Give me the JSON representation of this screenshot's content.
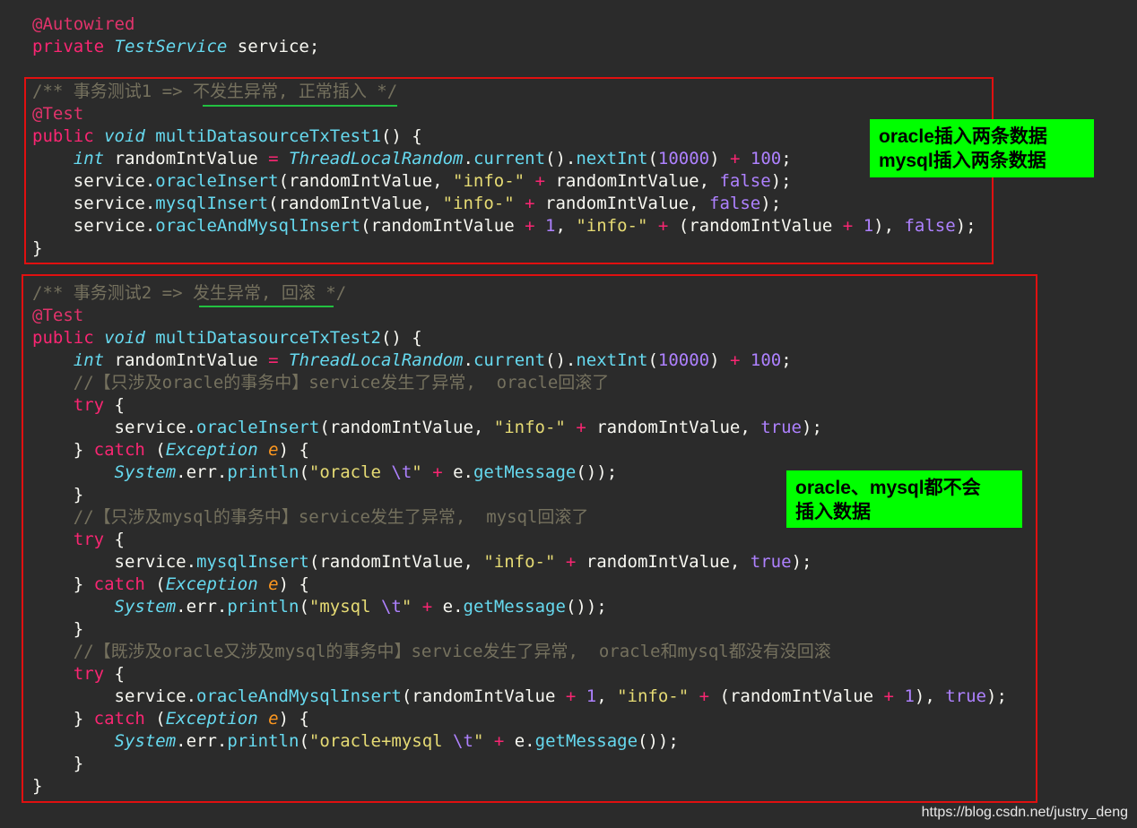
{
  "code_lines": [
    [
      {
        "c": "t-ann",
        "t": "@Autowired"
      }
    ],
    [
      {
        "c": "t-kw",
        "t": "private "
      },
      {
        "c": "t-cls",
        "t": "TestService"
      },
      {
        "c": "t-plain",
        "t": " service;"
      }
    ],
    [],
    [
      {
        "c": "t-cmt",
        "t": "/** 事务测试1 => 不发生异常, 正常插入 */"
      }
    ],
    [
      {
        "c": "t-ann",
        "t": "@Test"
      }
    ],
    [
      {
        "c": "t-kw",
        "t": "public "
      },
      {
        "c": "t-kwi",
        "t": "void"
      },
      {
        "c": "t-plain",
        "t": " "
      },
      {
        "c": "t-fn",
        "t": "multiDatasourceTxTest1"
      },
      {
        "c": "t-plain",
        "t": "() {"
      }
    ],
    [
      {
        "c": "t-plain",
        "t": "    "
      },
      {
        "c": "t-kwi",
        "t": "int"
      },
      {
        "c": "t-plain",
        "t": " randomIntValue "
      },
      {
        "c": "t-op",
        "t": "="
      },
      {
        "c": "t-plain",
        "t": " "
      },
      {
        "c": "t-cls",
        "t": "ThreadLocalRandom"
      },
      {
        "c": "t-plain",
        "t": "."
      },
      {
        "c": "t-fn",
        "t": "current"
      },
      {
        "c": "t-plain",
        "t": "()."
      },
      {
        "c": "t-fn",
        "t": "nextInt"
      },
      {
        "c": "t-plain",
        "t": "("
      },
      {
        "c": "t-num",
        "t": "10000"
      },
      {
        "c": "t-plain",
        "t": ") "
      },
      {
        "c": "t-op",
        "t": "+"
      },
      {
        "c": "t-plain",
        "t": " "
      },
      {
        "c": "t-num",
        "t": "100"
      },
      {
        "c": "t-plain",
        "t": ";"
      }
    ],
    [
      {
        "c": "t-plain",
        "t": "    service."
      },
      {
        "c": "t-fn",
        "t": "oracleInsert"
      },
      {
        "c": "t-plain",
        "t": "(randomIntValue, "
      },
      {
        "c": "t-str",
        "t": "\"info-\""
      },
      {
        "c": "t-plain",
        "t": " "
      },
      {
        "c": "t-op",
        "t": "+"
      },
      {
        "c": "t-plain",
        "t": " randomIntValue, "
      },
      {
        "c": "t-bool",
        "t": "false"
      },
      {
        "c": "t-plain",
        "t": ");"
      }
    ],
    [
      {
        "c": "t-plain",
        "t": "    service."
      },
      {
        "c": "t-fn",
        "t": "mysqlInsert"
      },
      {
        "c": "t-plain",
        "t": "(randomIntValue, "
      },
      {
        "c": "t-str",
        "t": "\"info-\""
      },
      {
        "c": "t-plain",
        "t": " "
      },
      {
        "c": "t-op",
        "t": "+"
      },
      {
        "c": "t-plain",
        "t": " randomIntValue, "
      },
      {
        "c": "t-bool",
        "t": "false"
      },
      {
        "c": "t-plain",
        "t": ");"
      }
    ],
    [
      {
        "c": "t-plain",
        "t": "    service."
      },
      {
        "c": "t-fn",
        "t": "oracleAndMysqlInsert"
      },
      {
        "c": "t-plain",
        "t": "(randomIntValue "
      },
      {
        "c": "t-op",
        "t": "+"
      },
      {
        "c": "t-plain",
        "t": " "
      },
      {
        "c": "t-num",
        "t": "1"
      },
      {
        "c": "t-plain",
        "t": ", "
      },
      {
        "c": "t-str",
        "t": "\"info-\""
      },
      {
        "c": "t-plain",
        "t": " "
      },
      {
        "c": "t-op",
        "t": "+"
      },
      {
        "c": "t-plain",
        "t": " (randomIntValue "
      },
      {
        "c": "t-op",
        "t": "+"
      },
      {
        "c": "t-plain",
        "t": " "
      },
      {
        "c": "t-num",
        "t": "1"
      },
      {
        "c": "t-plain",
        "t": "), "
      },
      {
        "c": "t-bool",
        "t": "false"
      },
      {
        "c": "t-plain",
        "t": ");"
      }
    ],
    [
      {
        "c": "t-plain",
        "t": "}"
      }
    ],
    [],
    [
      {
        "c": "t-cmt",
        "t": "/** 事务测试2 => 发生异常, 回滚 */"
      }
    ],
    [
      {
        "c": "t-ann",
        "t": "@Test"
      }
    ],
    [
      {
        "c": "t-kw",
        "t": "public "
      },
      {
        "c": "t-kwi",
        "t": "void"
      },
      {
        "c": "t-plain",
        "t": " "
      },
      {
        "c": "t-fn",
        "t": "multiDatasourceTxTest2"
      },
      {
        "c": "t-plain",
        "t": "() {"
      }
    ],
    [
      {
        "c": "t-plain",
        "t": "    "
      },
      {
        "c": "t-kwi",
        "t": "int"
      },
      {
        "c": "t-plain",
        "t": " randomIntValue "
      },
      {
        "c": "t-op",
        "t": "="
      },
      {
        "c": "t-plain",
        "t": " "
      },
      {
        "c": "t-cls",
        "t": "ThreadLocalRandom"
      },
      {
        "c": "t-plain",
        "t": "."
      },
      {
        "c": "t-fn",
        "t": "current"
      },
      {
        "c": "t-plain",
        "t": "()."
      },
      {
        "c": "t-fn",
        "t": "nextInt"
      },
      {
        "c": "t-plain",
        "t": "("
      },
      {
        "c": "t-num",
        "t": "10000"
      },
      {
        "c": "t-plain",
        "t": ") "
      },
      {
        "c": "t-op",
        "t": "+"
      },
      {
        "c": "t-plain",
        "t": " "
      },
      {
        "c": "t-num",
        "t": "100"
      },
      {
        "c": "t-plain",
        "t": ";"
      }
    ],
    [
      {
        "c": "t-plain",
        "t": "    "
      },
      {
        "c": "t-cmt",
        "t": "//【只涉及oracle的事务中】service发生了异常,  oracle回滚了"
      }
    ],
    [
      {
        "c": "t-plain",
        "t": "    "
      },
      {
        "c": "t-kw",
        "t": "try"
      },
      {
        "c": "t-plain",
        "t": " {"
      }
    ],
    [
      {
        "c": "t-plain",
        "t": "        service."
      },
      {
        "c": "t-fn",
        "t": "oracleInsert"
      },
      {
        "c": "t-plain",
        "t": "(randomIntValue, "
      },
      {
        "c": "t-str",
        "t": "\"info-\""
      },
      {
        "c": "t-plain",
        "t": " "
      },
      {
        "c": "t-op",
        "t": "+"
      },
      {
        "c": "t-plain",
        "t": " randomIntValue, "
      },
      {
        "c": "t-bool",
        "t": "true"
      },
      {
        "c": "t-plain",
        "t": ");"
      }
    ],
    [
      {
        "c": "t-plain",
        "t": "    } "
      },
      {
        "c": "t-kw",
        "t": "catch"
      },
      {
        "c": "t-plain",
        "t": " ("
      },
      {
        "c": "t-cls",
        "t": "Exception"
      },
      {
        "c": "t-plain",
        "t": " "
      },
      {
        "c": "t-param",
        "t": "e"
      },
      {
        "c": "t-plain",
        "t": ") {"
      }
    ],
    [
      {
        "c": "t-plain",
        "t": "        "
      },
      {
        "c": "t-cls",
        "t": "System"
      },
      {
        "c": "t-plain",
        "t": ".err."
      },
      {
        "c": "t-fn",
        "t": "println"
      },
      {
        "c": "t-plain",
        "t": "("
      },
      {
        "c": "t-str",
        "t": "\"oracle "
      },
      {
        "c": "t-esc",
        "t": "\\t"
      },
      {
        "c": "t-str",
        "t": "\""
      },
      {
        "c": "t-plain",
        "t": " "
      },
      {
        "c": "t-op",
        "t": "+"
      },
      {
        "c": "t-plain",
        "t": " e."
      },
      {
        "c": "t-fn",
        "t": "getMessage"
      },
      {
        "c": "t-plain",
        "t": "());"
      }
    ],
    [
      {
        "c": "t-plain",
        "t": "    }"
      }
    ],
    [
      {
        "c": "t-plain",
        "t": "    "
      },
      {
        "c": "t-cmt",
        "t": "//【只涉及mysql的事务中】service发生了异常,  mysql回滚了"
      }
    ],
    [
      {
        "c": "t-plain",
        "t": "    "
      },
      {
        "c": "t-kw",
        "t": "try"
      },
      {
        "c": "t-plain",
        "t": " {"
      }
    ],
    [
      {
        "c": "t-plain",
        "t": "        service."
      },
      {
        "c": "t-fn",
        "t": "mysqlInsert"
      },
      {
        "c": "t-plain",
        "t": "(randomIntValue, "
      },
      {
        "c": "t-str",
        "t": "\"info-\""
      },
      {
        "c": "t-plain",
        "t": " "
      },
      {
        "c": "t-op",
        "t": "+"
      },
      {
        "c": "t-plain",
        "t": " randomIntValue, "
      },
      {
        "c": "t-bool",
        "t": "true"
      },
      {
        "c": "t-plain",
        "t": ");"
      }
    ],
    [
      {
        "c": "t-plain",
        "t": "    } "
      },
      {
        "c": "t-kw",
        "t": "catch"
      },
      {
        "c": "t-plain",
        "t": " ("
      },
      {
        "c": "t-cls",
        "t": "Exception"
      },
      {
        "c": "t-plain",
        "t": " "
      },
      {
        "c": "t-param",
        "t": "e"
      },
      {
        "c": "t-plain",
        "t": ") {"
      }
    ],
    [
      {
        "c": "t-plain",
        "t": "        "
      },
      {
        "c": "t-cls",
        "t": "System"
      },
      {
        "c": "t-plain",
        "t": ".err."
      },
      {
        "c": "t-fn",
        "t": "println"
      },
      {
        "c": "t-plain",
        "t": "("
      },
      {
        "c": "t-str",
        "t": "\"mysql "
      },
      {
        "c": "t-esc",
        "t": "\\t"
      },
      {
        "c": "t-str",
        "t": "\""
      },
      {
        "c": "t-plain",
        "t": " "
      },
      {
        "c": "t-op",
        "t": "+"
      },
      {
        "c": "t-plain",
        "t": " e."
      },
      {
        "c": "t-fn",
        "t": "getMessage"
      },
      {
        "c": "t-plain",
        "t": "());"
      }
    ],
    [
      {
        "c": "t-plain",
        "t": "    }"
      }
    ],
    [
      {
        "c": "t-plain",
        "t": "    "
      },
      {
        "c": "t-cmt",
        "t": "//【既涉及oracle又涉及mysql的事务中】service发生了异常,  oracle和mysql都没有没回滚"
      }
    ],
    [
      {
        "c": "t-plain",
        "t": "    "
      },
      {
        "c": "t-kw",
        "t": "try"
      },
      {
        "c": "t-plain",
        "t": " {"
      }
    ],
    [
      {
        "c": "t-plain",
        "t": "        service."
      },
      {
        "c": "t-fn",
        "t": "oracleAndMysqlInsert"
      },
      {
        "c": "t-plain",
        "t": "(randomIntValue "
      },
      {
        "c": "t-op",
        "t": "+"
      },
      {
        "c": "t-plain",
        "t": " "
      },
      {
        "c": "t-num",
        "t": "1"
      },
      {
        "c": "t-plain",
        "t": ", "
      },
      {
        "c": "t-str",
        "t": "\"info-\""
      },
      {
        "c": "t-plain",
        "t": " "
      },
      {
        "c": "t-op",
        "t": "+"
      },
      {
        "c": "t-plain",
        "t": " (randomIntValue "
      },
      {
        "c": "t-op",
        "t": "+"
      },
      {
        "c": "t-plain",
        "t": " "
      },
      {
        "c": "t-num",
        "t": "1"
      },
      {
        "c": "t-plain",
        "t": "), "
      },
      {
        "c": "t-bool",
        "t": "true"
      },
      {
        "c": "t-plain",
        "t": ");"
      }
    ],
    [
      {
        "c": "t-plain",
        "t": "    } "
      },
      {
        "c": "t-kw",
        "t": "catch"
      },
      {
        "c": "t-plain",
        "t": " ("
      },
      {
        "c": "t-cls",
        "t": "Exception"
      },
      {
        "c": "t-plain",
        "t": " "
      },
      {
        "c": "t-param",
        "t": "e"
      },
      {
        "c": "t-plain",
        "t": ") {"
      }
    ],
    [
      {
        "c": "t-plain",
        "t": "        "
      },
      {
        "c": "t-cls",
        "t": "System"
      },
      {
        "c": "t-plain",
        "t": ".err."
      },
      {
        "c": "t-fn",
        "t": "println"
      },
      {
        "c": "t-plain",
        "t": "("
      },
      {
        "c": "t-str",
        "t": "\"oracle+mysql "
      },
      {
        "c": "t-esc",
        "t": "\\t"
      },
      {
        "c": "t-str",
        "t": "\""
      },
      {
        "c": "t-plain",
        "t": " "
      },
      {
        "c": "t-op",
        "t": "+"
      },
      {
        "c": "t-plain",
        "t": " e."
      },
      {
        "c": "t-fn",
        "t": "getMessage"
      },
      {
        "c": "t-plain",
        "t": "());"
      }
    ],
    [
      {
        "c": "t-plain",
        "t": "    }"
      }
    ],
    [
      {
        "c": "t-plain",
        "t": "}"
      }
    ]
  ],
  "notes": {
    "test1": [
      "oracle插入两条数据",
      "mysql插入两条数据"
    ],
    "test2": [
      "oracle、mysql都不会",
      "插入数据"
    ]
  },
  "watermark": "https://blog.csdn.net/justry_deng",
  "colors": {
    "background": "#2b2b2b",
    "highlight_box": "#e01010",
    "note_bg": "#00ff00",
    "underline": "#22c040"
  }
}
